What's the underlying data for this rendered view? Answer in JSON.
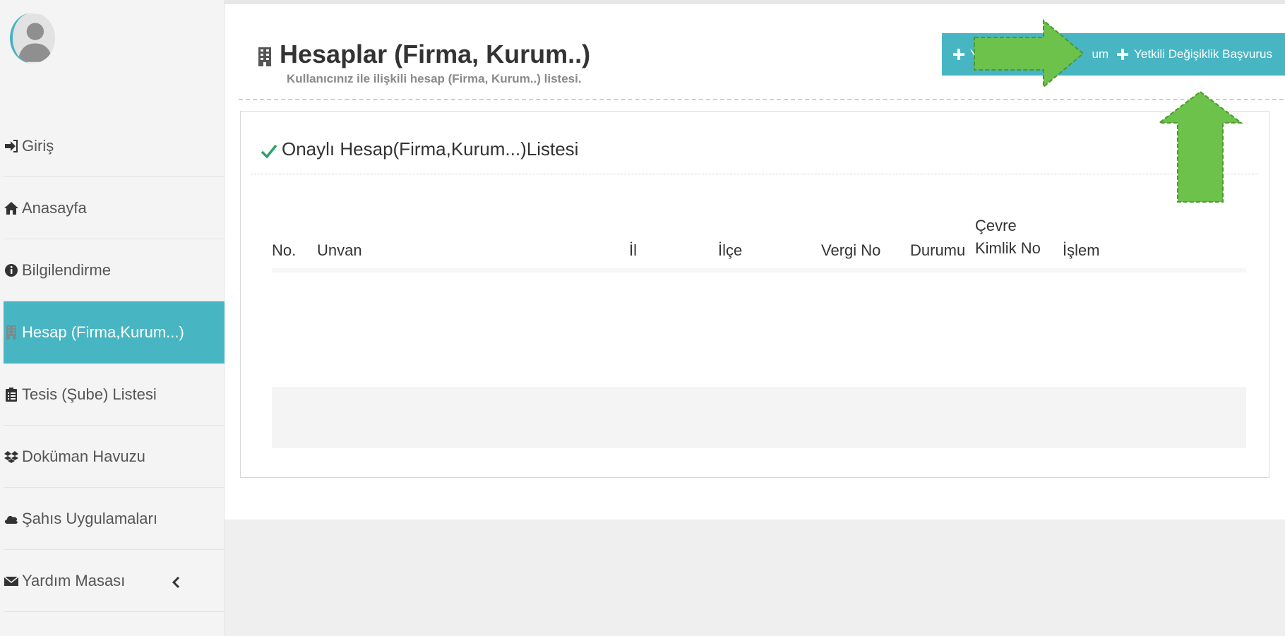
{
  "sidebar": {
    "items": [
      {
        "label": "Giriş",
        "icon": "sign-in-icon"
      },
      {
        "label": "Anasayfa",
        "icon": "home-icon"
      },
      {
        "label": "Bilgilendirme",
        "icon": "info-icon"
      },
      {
        "label": "Hesap (Firma,Kurum...)",
        "icon": "building-icon",
        "active": true
      },
      {
        "label": "Tesis (Şube) Listesi",
        "icon": "clipboard-icon"
      },
      {
        "label": "Doküman Havuzu",
        "icon": "dropbox-icon"
      },
      {
        "label": "Şahıs Uygulamaları",
        "icon": "cloud-icon"
      },
      {
        "label": "Yardım Masası",
        "icon": "envelope-icon",
        "has_submenu": true
      }
    ]
  },
  "header": {
    "title": "Hesaplar (Firma, Kurum..)",
    "subtitle": "Kullanıcınız ile ilişkili hesap (Firma, Kurum..) listesi."
  },
  "actions": {
    "new_button_left": "Ye",
    "new_button_right": "um",
    "authorized_change_button": "Yetkili Değişiklik Başvurus"
  },
  "panel": {
    "title": "Onaylı Hesap(Firma,Kurum...)Listesi"
  },
  "table": {
    "columns": [
      "No.",
      "Unvan",
      "İl",
      "İlçe",
      "Vergi No",
      "Durumu",
      "Çevre",
      "Kimlik No",
      "İşlem"
    ]
  },
  "colors": {
    "accent": "#48b5c3",
    "check": "#2aa36a",
    "arrow": "#6cc24a"
  }
}
